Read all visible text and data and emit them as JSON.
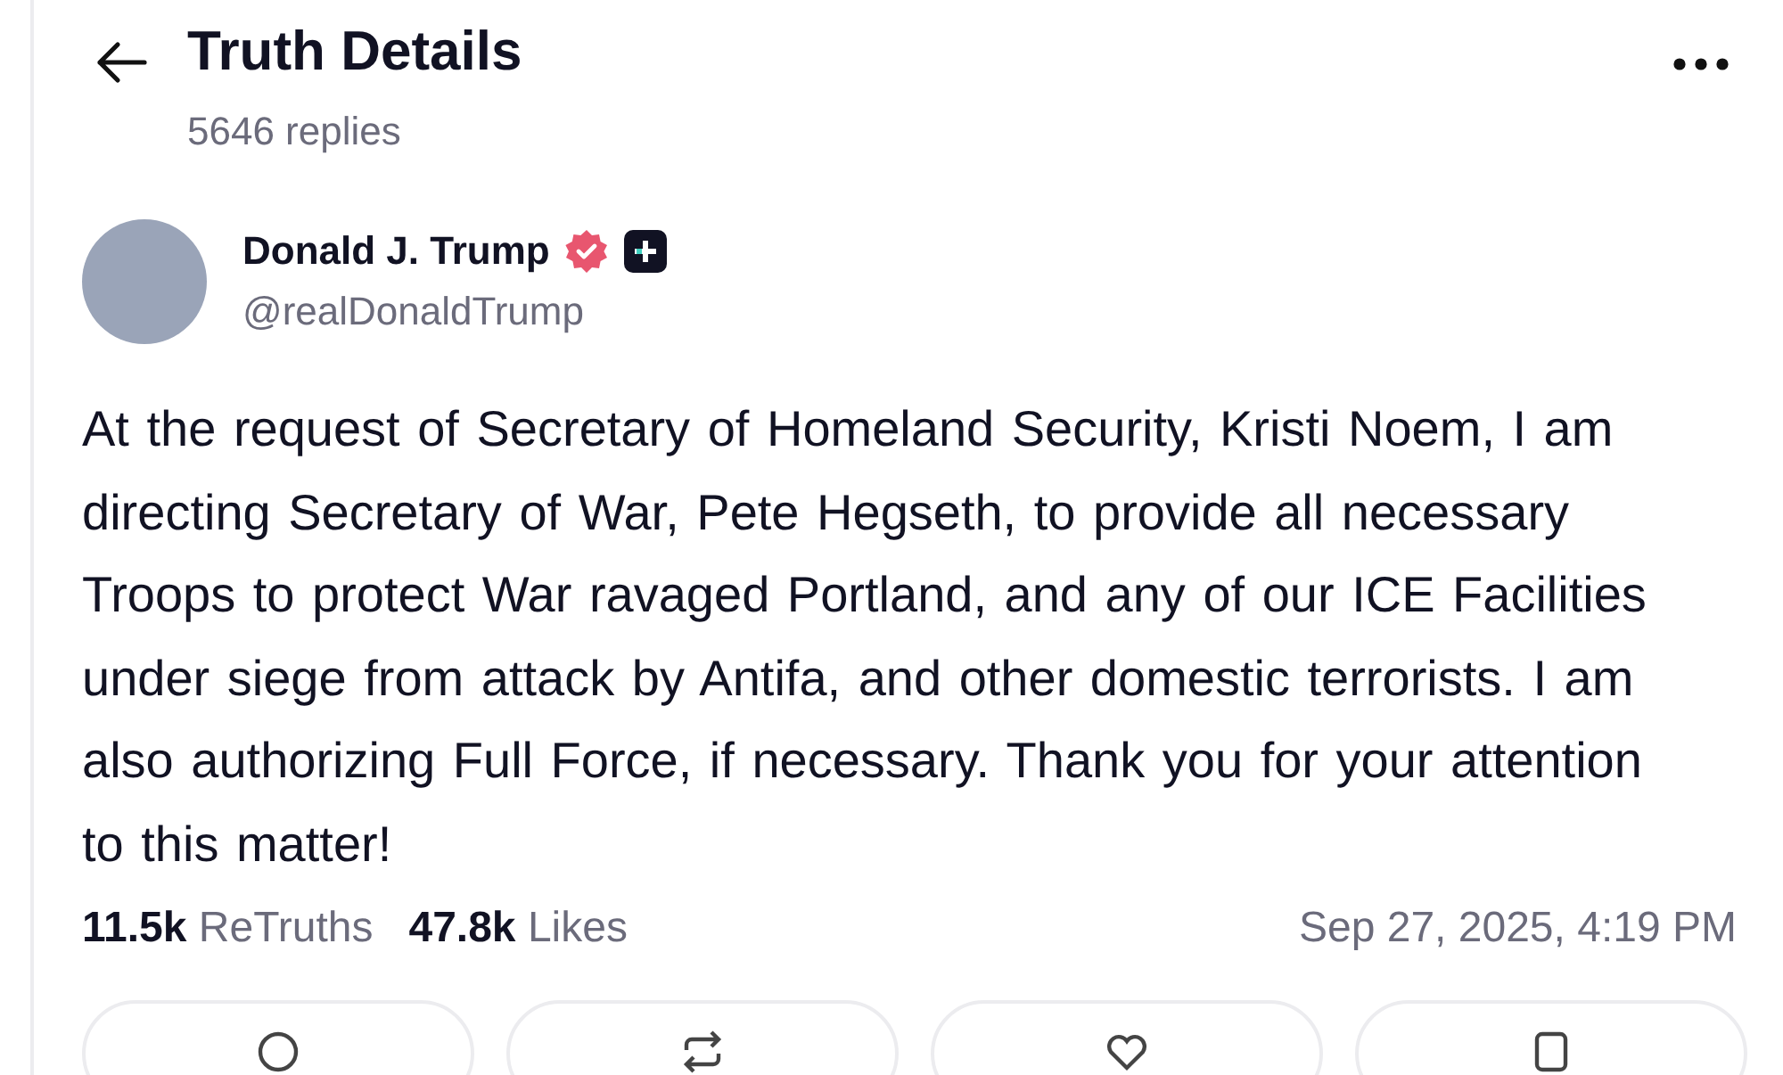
{
  "header": {
    "title": "Truth Details",
    "replies": "5646 replies"
  },
  "author": {
    "name": "Donald J. Trump",
    "handle": "@realDonaldTrump"
  },
  "post": {
    "text": "At the request of Secretary of Homeland Security, Kristi Noem, I am directing Secretary of War, Pete Hegseth, to provide all necessary Troops to protect War ravaged Portland, and any of our ICE Facilities under siege from attack by Antifa, and other domestic terrorists. I am also authorizing Full Force, if necessary. Thank you for your attention to this matter!"
  },
  "stats": [
    "**11.5k** ReTruths",
    "**47.8k** Likes"
  ],
  "timestamp": "Sep 27, 2025, 4:19 PM"
}
